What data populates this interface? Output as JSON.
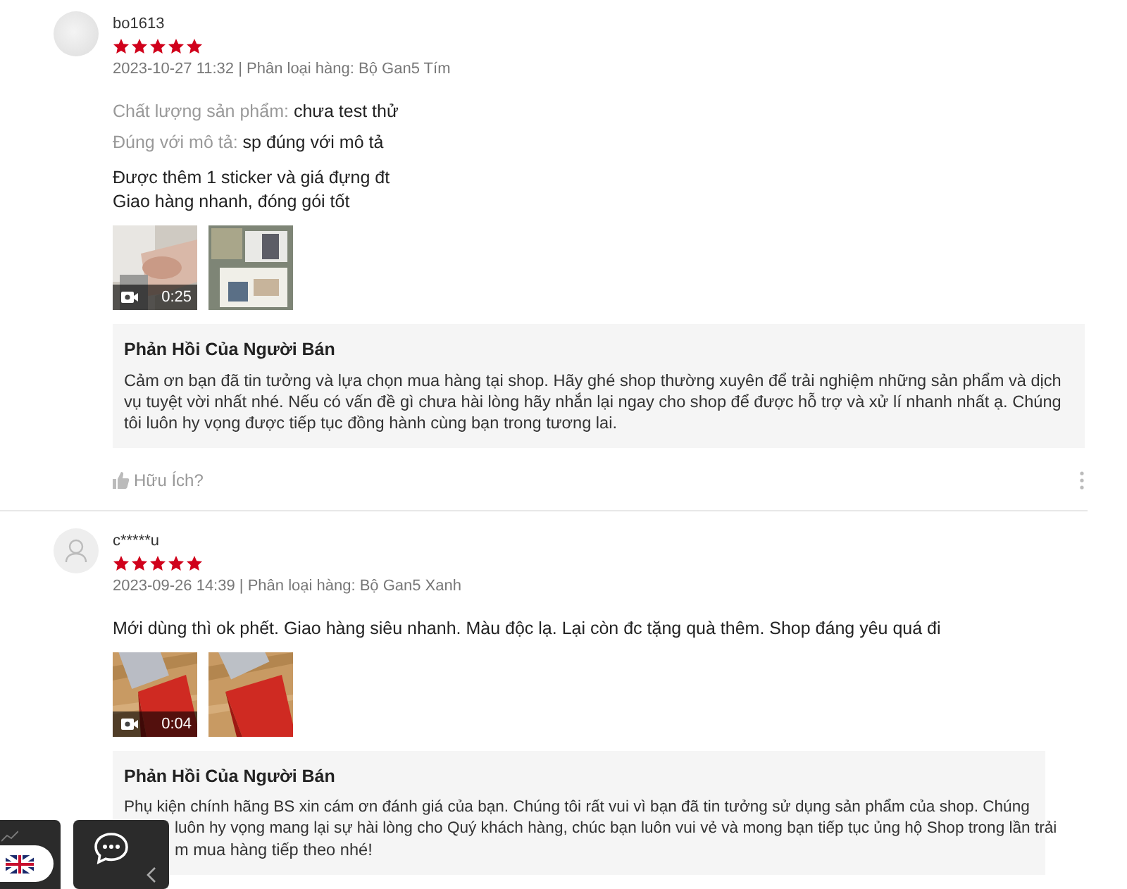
{
  "reviews": [
    {
      "avatar": {
        "kind": "picture"
      },
      "username": "bo1613",
      "stars": 5,
      "meta": "2023-10-27 11:32 | Phân loại hàng: Bộ Gan5 Tím",
      "attributes": [
        {
          "label": "Chất lượng sản phẩm:",
          "value": "chưa test thử"
        },
        {
          "label": "Đúng với mô tả:",
          "value": "sp đúng với mô tả"
        }
      ],
      "comment_lines": [
        "Được thêm 1 sticker và giá đựng đt",
        "Giao hàng nhanh, đóng gói tốt"
      ],
      "media": [
        {
          "kind": "video",
          "duration": "0:25"
        },
        {
          "kind": "picture"
        }
      ],
      "reply": {
        "title": "Phản Hồi Của Người Bán",
        "lines": [
          "Cảm ơn bạn đã tin tưởng và lựa chọn mua hàng tại shop. Hãy ghé shop thường xuyên để trải nghiệm những sản phẩm và dịch vụ tuyệt vời nhất nhé. Nếu có vấn đề gì chưa hài lòng hãy nhắn lại ngay cho shop để được hỗ trợ và xử lí nhanh nhất ạ. Chúng tôi luôn hy vọng được tiếp tục đồng hành cùng bạn trong tương lai."
        ]
      },
      "helpful": "Hữu Ích?"
    },
    {
      "avatar": {
        "kind": "icon"
      },
      "username": "c*****u",
      "stars": 5,
      "meta": "2023-09-26 14:39 | Phân loại hàng: Bộ Gan5 Xanh",
      "comment_lines": [
        "Mới dùng thì ok phết. Giao hàng siêu nhanh. Màu độc lạ. Lại còn đc tặng quà thêm. Shop đáng yêu quá đi"
      ],
      "media": [
        {
          "kind": "video",
          "duration": "0:04"
        },
        {
          "kind": "picture"
        }
      ],
      "reply": {
        "title": "Phản Hồi Của Người Bán",
        "lines": [
          "Phụ kiện chính hãng BS xin cám ơn đánh giá của bạn. Chúng tôi rất vui vì bạn đã tin tưởng sử dụng sản phẩm của shop. Chúng",
          "luôn hy vọng mang lại sự hài lòng cho Quý khách hàng, chúc bạn luôn vui vẻ và mong bạn tiếp tục ủng hộ Shop trong lần trải",
          "m mua hàng tiếp theo nhé!"
        ]
      }
    }
  ]
}
